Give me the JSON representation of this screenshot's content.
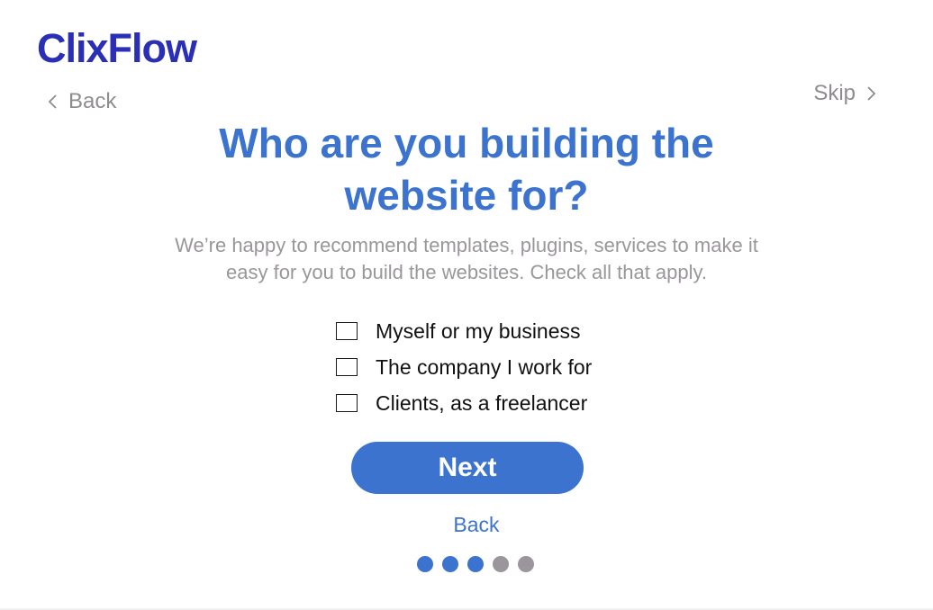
{
  "brand": {
    "logo_text": "ClixFlow",
    "color": "#2b2fb5"
  },
  "nav": {
    "back_label": "Back",
    "back_icon": "chevron-left-icon",
    "skip_label": "Skip",
    "skip_icon": "chevron-right-icon"
  },
  "main": {
    "title_line1": "Who are you building the",
    "title_line2": "website for?",
    "subtitle_line1": "We’re happy to recommend templates, plugins, services to make it",
    "subtitle_line2": "easy for you to build the websites. Check all that apply.",
    "options": [
      {
        "label": "Myself or my business",
        "checked": false
      },
      {
        "label": "The company I work for",
        "checked": false
      },
      {
        "label": "Clients, as a freelancer",
        "checked": false
      }
    ],
    "next_label": "Next",
    "back_link_label": "Back"
  },
  "progress": {
    "total_steps": 5,
    "current_step": 3
  },
  "colors": {
    "accent": "#3b73cf",
    "muted": "#9a969b",
    "text": "#111111"
  }
}
